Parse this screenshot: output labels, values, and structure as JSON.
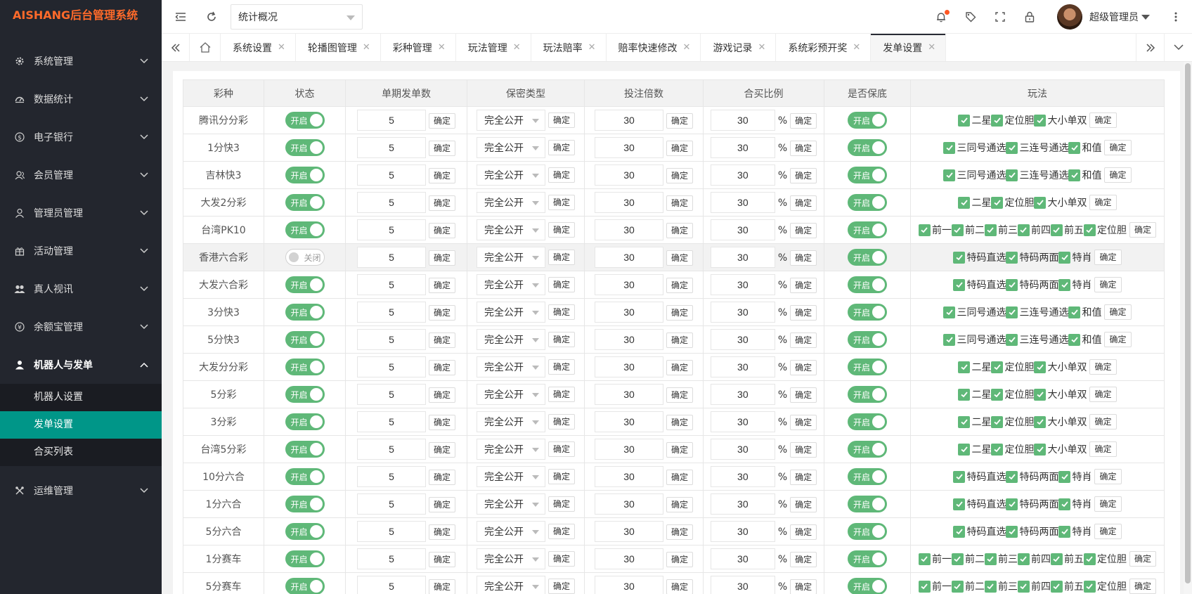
{
  "app": {
    "logo_text": "AISHANG后台管理系统"
  },
  "sidebar": {
    "items": [
      {
        "label": "系统管理",
        "icon": "gear-icon"
      },
      {
        "label": "数据统计",
        "icon": "dashboard-icon"
      },
      {
        "label": "电子银行",
        "icon": "dollar-icon"
      },
      {
        "label": "会员管理",
        "icon": "users-icon"
      },
      {
        "label": "管理员管理",
        "icon": "user-icon"
      },
      {
        "label": "活动管理",
        "icon": "gift-icon"
      },
      {
        "label": "真人视讯",
        "icon": "group-icon"
      },
      {
        "label": "余额宝管理",
        "icon": "yen-icon"
      },
      {
        "label": "机器人与发单",
        "icon": "person-icon"
      },
      {
        "label": "运维管理",
        "icon": "tools-icon"
      }
    ],
    "submenu": [
      {
        "label": "机器人设置"
      },
      {
        "label": "发单设置"
      },
      {
        "label": "合买列表"
      }
    ]
  },
  "topbar": {
    "breadcrumb_value": "统计概况",
    "user_name": "超级管理员"
  },
  "tabs": [
    {
      "label": "系统设置"
    },
    {
      "label": "轮播图管理"
    },
    {
      "label": "彩种管理"
    },
    {
      "label": "玩法管理"
    },
    {
      "label": "玩法赔率"
    },
    {
      "label": "赔率快速修改"
    },
    {
      "label": "游戏记录"
    },
    {
      "label": "系统彩预开奖"
    },
    {
      "label": "发单设置"
    }
  ],
  "table": {
    "headers": [
      "彩种",
      "状态",
      "单期发单数",
      "保密类型",
      "投注倍数",
      "合买比例",
      "是否保底",
      "玩法"
    ],
    "on_label": "开启",
    "off_label": "关闭",
    "confirm_label": "确定",
    "percent_sign": "%",
    "rows": [
      {
        "name": "腾讯分分彩",
        "status": "开启",
        "count": "5",
        "secrecy": "完全公开",
        "multiple": "30",
        "ratio": "30",
        "guarantee": "开启",
        "plays": [
          "二星",
          "定位胆",
          "大小单双"
        ]
      },
      {
        "name": "1分快3",
        "status": "开启",
        "count": "5",
        "secrecy": "完全公开",
        "multiple": "30",
        "ratio": "30",
        "guarantee": "开启",
        "plays": [
          "三同号通选",
          "三连号通选",
          "和值"
        ]
      },
      {
        "name": "吉林快3",
        "status": "开启",
        "count": "5",
        "secrecy": "完全公开",
        "multiple": "30",
        "ratio": "30",
        "guarantee": "开启",
        "plays": [
          "三同号通选",
          "三连号通选",
          "和值"
        ]
      },
      {
        "name": "大发2分彩",
        "status": "开启",
        "count": "5",
        "secrecy": "完全公开",
        "multiple": "30",
        "ratio": "30",
        "guarantee": "开启",
        "plays": [
          "二星",
          "定位胆",
          "大小单双"
        ]
      },
      {
        "name": "台湾PK10",
        "status": "开启",
        "count": "5",
        "secrecy": "完全公开",
        "multiple": "30",
        "ratio": "30",
        "guarantee": "开启",
        "plays": [
          "前一",
          "前二",
          "前三",
          "前四",
          "前五",
          "定位胆"
        ]
      },
      {
        "name": "香港六合彩",
        "status": "关闭",
        "count": "5",
        "secrecy": "完全公开",
        "multiple": "30",
        "ratio": "30",
        "guarantee": "开启",
        "plays": [
          "特码直选",
          "特码两面",
          "特肖"
        ]
      },
      {
        "name": "大发六合彩",
        "status": "开启",
        "count": "5",
        "secrecy": "完全公开",
        "multiple": "30",
        "ratio": "30",
        "guarantee": "开启",
        "plays": [
          "特码直选",
          "特码两面",
          "特肖"
        ]
      },
      {
        "name": "3分快3",
        "status": "开启",
        "count": "5",
        "secrecy": "完全公开",
        "multiple": "30",
        "ratio": "30",
        "guarantee": "开启",
        "plays": [
          "三同号通选",
          "三连号通选",
          "和值"
        ]
      },
      {
        "name": "5分快3",
        "status": "开启",
        "count": "5",
        "secrecy": "完全公开",
        "multiple": "30",
        "ratio": "30",
        "guarantee": "开启",
        "plays": [
          "三同号通选",
          "三连号通选",
          "和值"
        ]
      },
      {
        "name": "大发分分彩",
        "status": "开启",
        "count": "5",
        "secrecy": "完全公开",
        "multiple": "30",
        "ratio": "30",
        "guarantee": "开启",
        "plays": [
          "二星",
          "定位胆",
          "大小单双"
        ]
      },
      {
        "name": "5分彩",
        "status": "开启",
        "count": "5",
        "secrecy": "完全公开",
        "multiple": "30",
        "ratio": "30",
        "guarantee": "开启",
        "plays": [
          "二星",
          "定位胆",
          "大小单双"
        ]
      },
      {
        "name": "3分彩",
        "status": "开启",
        "count": "5",
        "secrecy": "完全公开",
        "multiple": "30",
        "ratio": "30",
        "guarantee": "开启",
        "plays": [
          "二星",
          "定位胆",
          "大小单双"
        ]
      },
      {
        "name": "台湾5分彩",
        "status": "开启",
        "count": "5",
        "secrecy": "完全公开",
        "multiple": "30",
        "ratio": "30",
        "guarantee": "开启",
        "plays": [
          "二星",
          "定位胆",
          "大小单双"
        ]
      },
      {
        "name": "10分六合",
        "status": "开启",
        "count": "5",
        "secrecy": "完全公开",
        "multiple": "30",
        "ratio": "30",
        "guarantee": "开启",
        "plays": [
          "特码直选",
          "特码两面",
          "特肖"
        ]
      },
      {
        "name": "1分六合",
        "status": "开启",
        "count": "5",
        "secrecy": "完全公开",
        "multiple": "30",
        "ratio": "30",
        "guarantee": "开启",
        "plays": [
          "特码直选",
          "特码两面",
          "特肖"
        ]
      },
      {
        "name": "5分六合",
        "status": "开启",
        "count": "5",
        "secrecy": "完全公开",
        "multiple": "30",
        "ratio": "30",
        "guarantee": "开启",
        "plays": [
          "特码直选",
          "特码两面",
          "特肖"
        ]
      },
      {
        "name": "1分赛车",
        "status": "开启",
        "count": "5",
        "secrecy": "完全公开",
        "multiple": "30",
        "ratio": "30",
        "guarantee": "开启",
        "plays": [
          "前一",
          "前二",
          "前三",
          "前四",
          "前五",
          "定位胆"
        ]
      },
      {
        "name": "5分赛车",
        "status": "开启",
        "count": "5",
        "secrecy": "完全公开",
        "multiple": "30",
        "ratio": "30",
        "guarantee": "开启",
        "plays": [
          "前一",
          "前二",
          "前三",
          "前四",
          "前五",
          "定位胆"
        ]
      }
    ]
  }
}
